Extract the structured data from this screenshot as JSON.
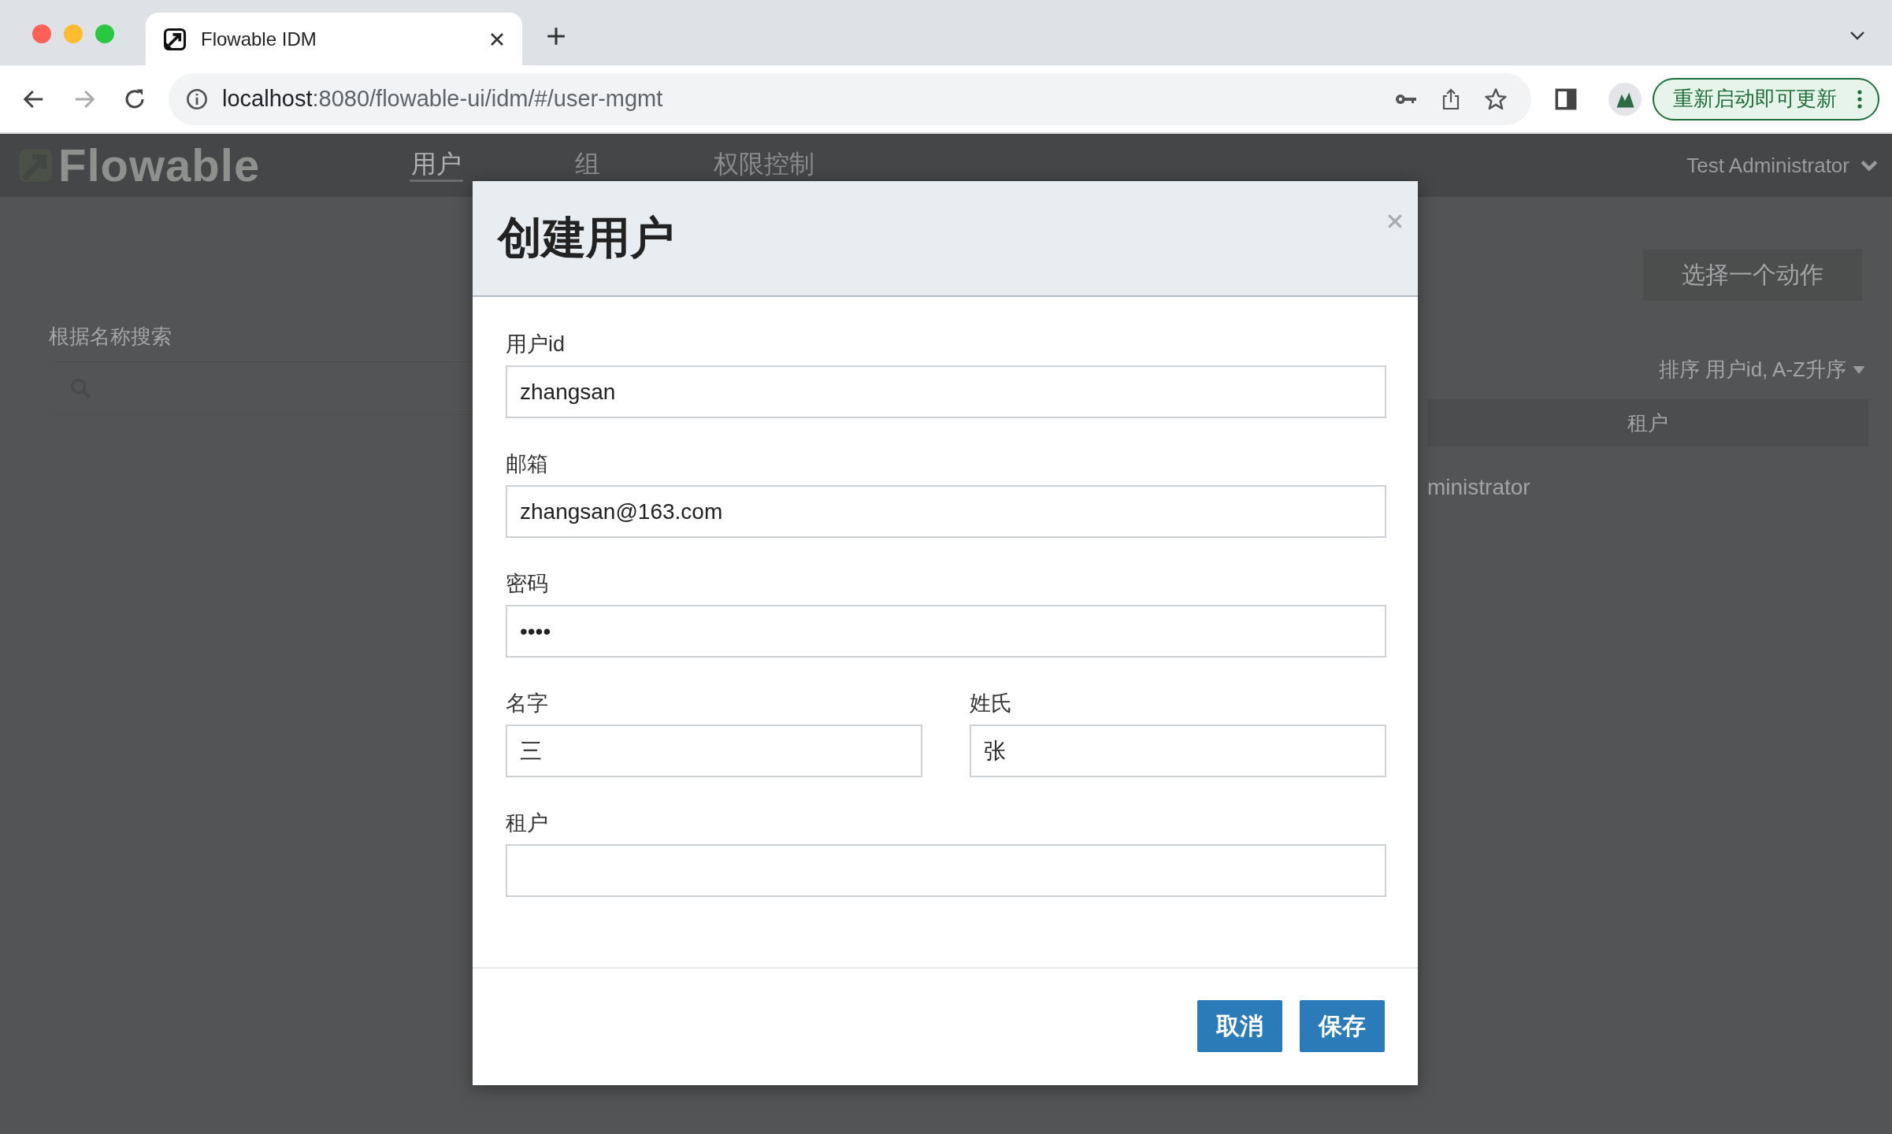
{
  "browser": {
    "tab": {
      "title": "Flowable IDM",
      "selected": true
    },
    "address": {
      "host": "localhost",
      "path": ":8080/flowable-ui/idm/#/user-mgmt"
    },
    "update_button": "重新启动即可更新"
  },
  "app": {
    "logo": "Flowable",
    "nav": [
      {
        "label": "用户",
        "selected": true
      },
      {
        "label": "组",
        "selected": false
      },
      {
        "label": "权限控制",
        "selected": false
      }
    ],
    "user_menu": "Test Administrator",
    "search_label": "根据名称搜索",
    "action_button": "选择一个动作",
    "sort": "排序 用户id, A-Z升序",
    "table_header": "租户",
    "row_text": "ministrator"
  },
  "dialog": {
    "title": "创建用户",
    "fields": [
      {
        "label": "用户id",
        "value": "zhangsan"
      },
      {
        "label": "邮箱",
        "value": "zhangsan@163.com"
      },
      {
        "label": "密码",
        "value": "••••"
      }
    ],
    "name_fields": [
      {
        "label": "名字",
        "value": "三"
      },
      {
        "label": "姓氏",
        "value": "张"
      }
    ],
    "tenant": {
      "label": "租户"
    },
    "buttons": [
      {
        "label": "取消"
      },
      {
        "label": "保存"
      }
    ]
  }
}
